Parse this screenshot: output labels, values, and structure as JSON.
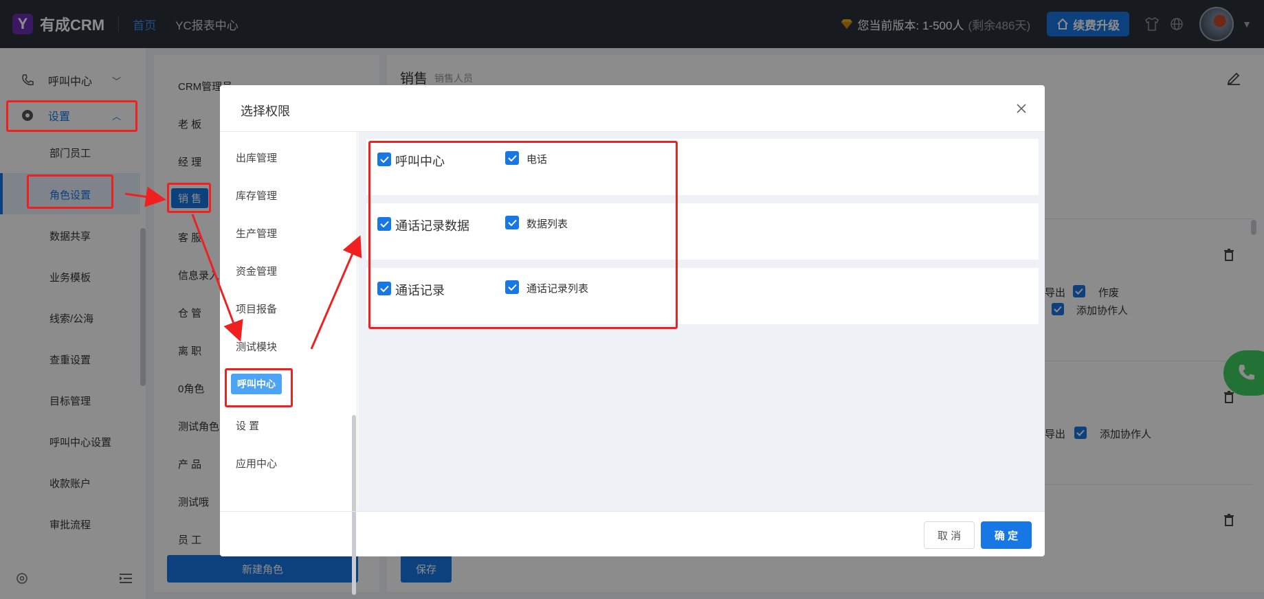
{
  "topbar": {
    "logo_text": "有成CRM",
    "nav": [
      "首页",
      "YC报表中心"
    ],
    "version": "您当前版本: 1-500人",
    "remaining": "(剩余486天)",
    "upgrade_label": "续费升级"
  },
  "sidebar": {
    "call_center": "呼叫中心",
    "settings": "设置",
    "sub_items": [
      "部门员工",
      "角色设置",
      "数据共享",
      "业务模板",
      "线索/公海",
      "查重设置",
      "目标管理",
      "呼叫中心设置",
      "收款账户",
      "审批流程"
    ]
  },
  "roles": {
    "items": [
      "CRM管理员",
      "老 板",
      "经 理",
      "销 售",
      "客 服",
      "信息录入",
      "仓 管",
      "离 职",
      "0角色",
      "测试角色",
      "产 品",
      "测试哦",
      "员 工"
    ],
    "new_role_label": "新建角色"
  },
  "content": {
    "title": "销售",
    "subtitle": "销售人员",
    "texts": [
      "导出",
      "作废",
      "添加协作人",
      "导出",
      "添加协作人"
    ],
    "save_label": "保存"
  },
  "modal": {
    "title": "选择权限",
    "modules": [
      "出库管理",
      "库存管理",
      "生产管理",
      "资金管理",
      "项目报备",
      "测试模块",
      "呼叫中心",
      "设 置",
      "应用中心"
    ],
    "permissions": [
      {
        "main": "呼叫中心",
        "sub": "电话"
      },
      {
        "main": "通话记录数据",
        "sub": "数据列表"
      },
      {
        "main": "通话记录",
        "sub": "通话记录列表"
      }
    ],
    "cancel_label": "取 消",
    "ok_label": "确 定"
  },
  "colors": {
    "accent": "#1677e5",
    "topbar": "#2b3139",
    "annotation": "#f02020",
    "fab": "#3ecf62"
  }
}
